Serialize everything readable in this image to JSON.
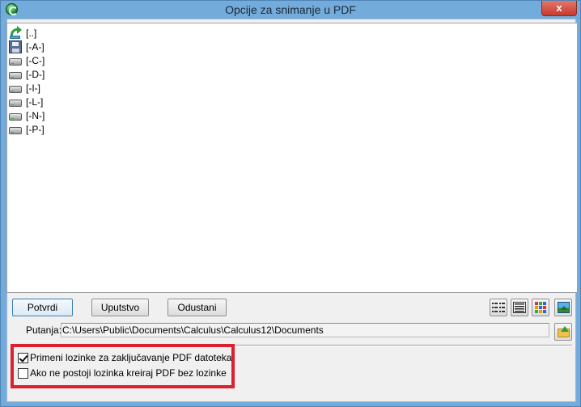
{
  "window": {
    "title": "Opcije za snimanje u PDF",
    "close_label": "x"
  },
  "file_list": {
    "items": [
      {
        "label": "[..]",
        "icon": "folder-up-icon"
      },
      {
        "label": "[-A-]",
        "icon": "floppy-drive-icon"
      },
      {
        "label": "[-C-]",
        "icon": "hard-drive-icon"
      },
      {
        "label": "[-D-]",
        "icon": "hard-drive-icon"
      },
      {
        "label": "[-I-]",
        "icon": "hard-drive-icon"
      },
      {
        "label": "[-L-]",
        "icon": "hard-drive-icon"
      },
      {
        "label": "[-N-]",
        "icon": "hard-drive-icon"
      },
      {
        "label": "[-P-]",
        "icon": "hard-drive-icon"
      }
    ]
  },
  "buttons": {
    "confirm": "Potvrdi",
    "help": "Uputstvo",
    "cancel": "Odustani"
  },
  "view_buttons": [
    "view-list-icon",
    "view-details-icon",
    "view-icons-icon",
    "view-thumbnails-icon"
  ],
  "path": {
    "label": "Putanja:",
    "value": "C:\\Users\\Public\\Documents\\Calculus\\Calculus12\\Documents"
  },
  "options": {
    "apply_passwords": {
      "label": "Primeni lozinke za zaključavanje PDF datoteka",
      "checked": true
    },
    "create_without_password": {
      "label": "Ako ne postoji lozinka kreiraj PDF bez lozinke",
      "checked": false
    }
  },
  "colors": {
    "highlight": "#dc2030",
    "window_frame": "#73abda"
  }
}
